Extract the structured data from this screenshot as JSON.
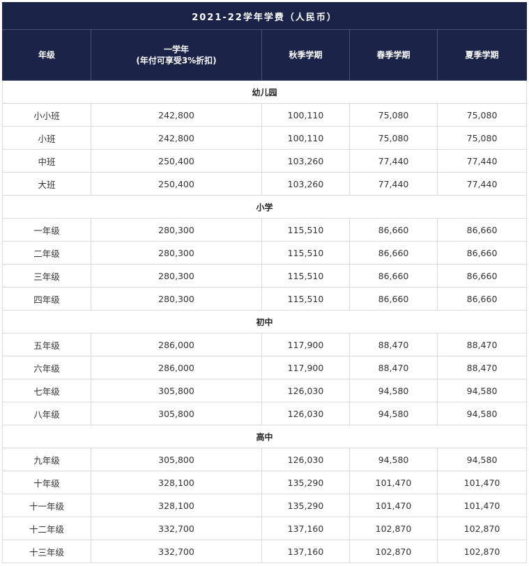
{
  "title": "2021-22学年学费（人民币）",
  "headers": {
    "grade": "年级",
    "annual_line1": "一学年",
    "annual_line2": "(年付可享受3%折扣)",
    "autumn": "秋季学期",
    "spring": "春季学期",
    "summer": "夏季学期"
  },
  "sections": [
    {
      "name": "幼儿园",
      "rows": [
        {
          "grade": "小小班",
          "annual": "242,800",
          "autumn": "100,110",
          "spring": "75,080",
          "summer": "75,080"
        },
        {
          "grade": "小班",
          "annual": "242,800",
          "autumn": "100,110",
          "spring": "75,080",
          "summer": "75,080"
        },
        {
          "grade": "中班",
          "annual": "250,400",
          "autumn": "103,260",
          "spring": "77,440",
          "summer": "77,440"
        },
        {
          "grade": "大班",
          "annual": "250,400",
          "autumn": "103,260",
          "spring": "77,440",
          "summer": "77,440"
        }
      ]
    },
    {
      "name": "小学",
      "rows": [
        {
          "grade": "一年级",
          "annual": "280,300",
          "autumn": "115,510",
          "spring": "86,660",
          "summer": "86,660"
        },
        {
          "grade": "二年级",
          "annual": "280,300",
          "autumn": "115,510",
          "spring": "86,660",
          "summer": "86,660"
        },
        {
          "grade": "三年级",
          "annual": "280,300",
          "autumn": "115,510",
          "spring": "86,660",
          "summer": "86,660"
        },
        {
          "grade": "四年级",
          "annual": "280,300",
          "autumn": "115,510",
          "spring": "86,660",
          "summer": "86,660"
        }
      ]
    },
    {
      "name": "初中",
      "rows": [
        {
          "grade": "五年级",
          "annual": "286,000",
          "autumn": "117,900",
          "spring": "88,470",
          "summer": "88,470"
        },
        {
          "grade": "六年级",
          "annual": "286,000",
          "autumn": "117,900",
          "spring": "88,470",
          "summer": "88,470"
        },
        {
          "grade": "七年级",
          "annual": "305,800",
          "autumn": "126,030",
          "spring": "94,580",
          "summer": "94,580"
        },
        {
          "grade": "八年级",
          "annual": "305,800",
          "autumn": "126,030",
          "spring": "94,580",
          "summer": "94,580"
        }
      ]
    },
    {
      "name": "高中",
      "rows": [
        {
          "grade": "九年级",
          "annual": "305,800",
          "autumn": "126,030",
          "spring": "94,580",
          "summer": "94,580"
        },
        {
          "grade": "十年级",
          "annual": "328,100",
          "autumn": "135,290",
          "spring": "101,470",
          "summer": "101,470"
        },
        {
          "grade": "十一年级",
          "annual": "328,100",
          "autumn": "135,290",
          "spring": "101,470",
          "summer": "101,470"
        },
        {
          "grade": "十二年级",
          "annual": "332,700",
          "autumn": "137,160",
          "spring": "102,870",
          "summer": "102,870"
        },
        {
          "grade": "十三年级",
          "annual": "332,700",
          "autumn": "137,160",
          "spring": "102,870",
          "summer": "102,870"
        }
      ]
    }
  ],
  "colors": {
    "header_bg": "#1b2348",
    "header_text": "#ffffff",
    "border": "#d9d9d9"
  }
}
